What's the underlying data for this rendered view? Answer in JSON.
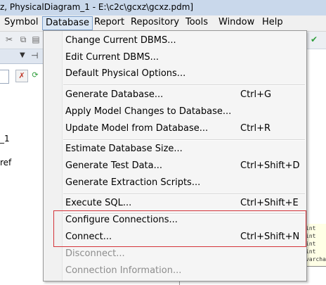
{
  "window": {
    "title": "z, PhysicalDiagram_1 - E:\\c2c\\gcxz\\gcxz.pdm]"
  },
  "menubar": {
    "items": [
      "Symbol",
      "Database",
      "Report",
      "Repository",
      "Tools",
      "Window",
      "Help"
    ],
    "active": "Database"
  },
  "browser": {
    "tree": [
      "_1",
      "ref"
    ]
  },
  "diagram": {
    "rows": [
      "int",
      "int",
      "int",
      "int",
      "varchar"
    ]
  },
  "database_menu": {
    "items": [
      {
        "label": "Change Current DBMS...",
        "shortcut": ""
      },
      {
        "label": "Edit Current DBMS...",
        "shortcut": ""
      },
      {
        "label": "Default Physical Options...",
        "shortcut": ""
      },
      {
        "label": "Generate Database...",
        "shortcut": "Ctrl+G"
      },
      {
        "label": "Apply Model Changes to Database...",
        "shortcut": ""
      },
      {
        "label": "Update Model from Database...",
        "shortcut": "Ctrl+R"
      },
      {
        "label": "Estimate Database Size...",
        "shortcut": ""
      },
      {
        "label": "Generate Test Data...",
        "shortcut": "Ctrl+Shift+D"
      },
      {
        "label": "Generate Extraction Scripts...",
        "shortcut": ""
      },
      {
        "label": "Execute SQL...",
        "shortcut": "Ctrl+Shift+E"
      },
      {
        "label": "Configure Connections...",
        "shortcut": ""
      },
      {
        "label": "Connect...",
        "shortcut": "Ctrl+Shift+N"
      },
      {
        "label": "Disconnect...",
        "shortcut": ""
      },
      {
        "label": "Connection Information...",
        "shortcut": ""
      }
    ]
  },
  "colors": {
    "highlight_border": "#d4343a",
    "disabled_text": "#8d8d8d"
  }
}
